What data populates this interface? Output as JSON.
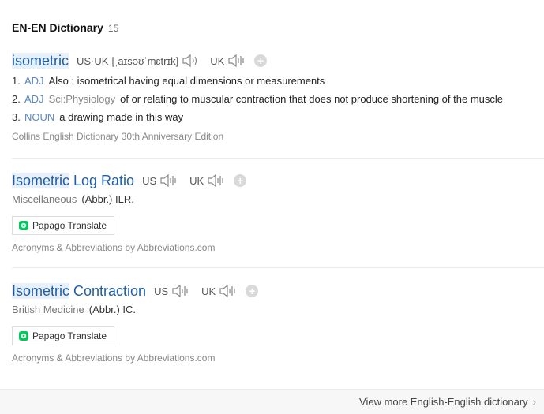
{
  "header": {
    "title": "EN-EN Dictionary",
    "count": "15"
  },
  "entries": [
    {
      "word_hl": "isometric",
      "word_rest": "",
      "us_uk_label": "US·UK",
      "pronunciation": "[ˌaɪsəʊˈmɛtrɪk]",
      "uk_label": "UK",
      "definitions": [
        {
          "num": "1.",
          "pos": "ADJ",
          "domain": "",
          "text": "Also : isometrical having equal dimensions or measurements"
        },
        {
          "num": "2.",
          "pos": "ADJ",
          "domain": "Sci:Physiology",
          "text": "of or relating to muscular contraction that does not produce shortening of the muscle"
        },
        {
          "num": "3.",
          "pos": "NOUN",
          "domain": "",
          "text": "a drawing made in this way"
        }
      ],
      "source": "Collins English Dictionary 30th Anniversary Edition"
    },
    {
      "word_hl": "Isometric",
      "word_rest": " Log Ratio",
      "us_label": "US",
      "uk_label": "UK",
      "category": "Miscellaneous",
      "abbr": "(Abbr.) ILR.",
      "translate_label": "Papago Translate",
      "source": "Acronyms & Abbreviations by Abbreviations.com"
    },
    {
      "word_hl": "Isometric",
      "word_rest": " Contraction",
      "us_label": "US",
      "uk_label": "UK",
      "category": "British Medicine",
      "abbr": "(Abbr.) IC.",
      "translate_label": "Papago Translate",
      "source": "Acronyms & Abbreviations by Abbreviations.com"
    }
  ],
  "footer": {
    "more_label": "View more English-English dictionary"
  },
  "colors": {
    "link": "#1f5fa8",
    "pos": "#5b86c6",
    "highlight": "#e8f1fb",
    "papago_green": "#03c75a"
  }
}
